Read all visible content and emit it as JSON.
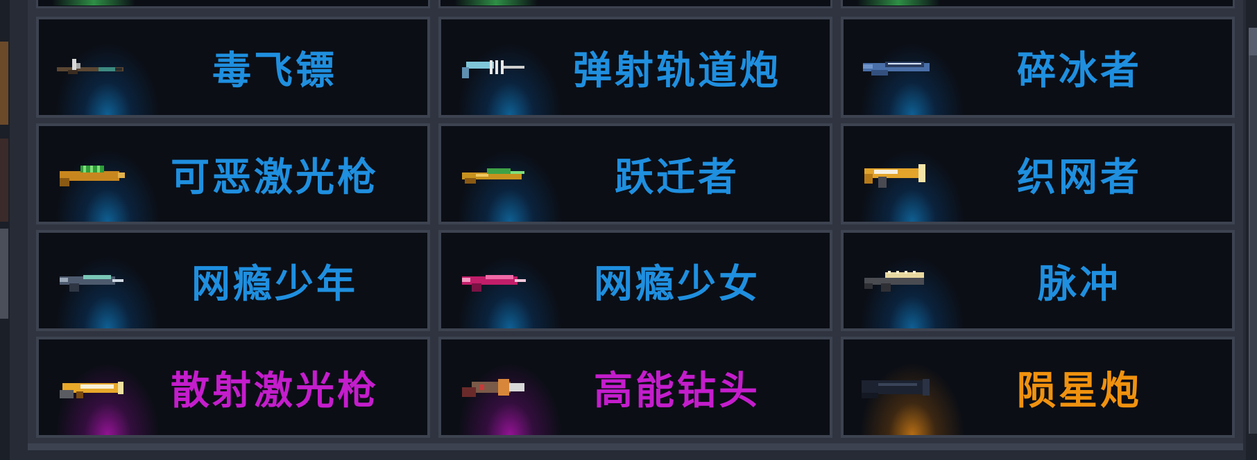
{
  "colors": {
    "common": "#1f8fdf",
    "rare": "#c41dcc",
    "legendary": "#f0920f"
  },
  "weapons": [
    {
      "name": "毒飞镖",
      "rarity": "common",
      "icon": "poison-dart-icon"
    },
    {
      "name": "弹射轨道炮",
      "rarity": "common",
      "icon": "bounce-railgun-icon"
    },
    {
      "name": "碎冰者",
      "rarity": "common",
      "icon": "ice-breaker-icon"
    },
    {
      "name": "可恶激光枪",
      "rarity": "common",
      "icon": "nasty-laser-gun-icon"
    },
    {
      "name": "跃迁者",
      "rarity": "common",
      "icon": "warper-gun-icon"
    },
    {
      "name": "织网者",
      "rarity": "common",
      "icon": "web-weaver-icon"
    },
    {
      "name": "网瘾少年",
      "rarity": "common",
      "icon": "net-addict-boy-icon"
    },
    {
      "name": "网瘾少女",
      "rarity": "common",
      "icon": "net-addict-girl-icon"
    },
    {
      "name": "脉冲",
      "rarity": "common",
      "icon": "pulse-gun-icon"
    },
    {
      "name": "散射激光枪",
      "rarity": "rare",
      "icon": "scatter-laser-gun-icon"
    },
    {
      "name": "高能钻头",
      "rarity": "rare",
      "icon": "power-drill-icon"
    },
    {
      "name": "陨星炮",
      "rarity": "legendary",
      "icon": "meteor-cannon-icon"
    }
  ]
}
